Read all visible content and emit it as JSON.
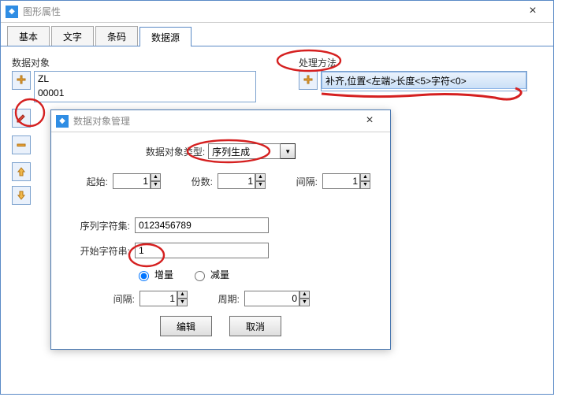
{
  "window": {
    "title": "图形属性",
    "close_glyph": "×"
  },
  "tabs": {
    "items": [
      "基本",
      "文字",
      "条码",
      "数据源"
    ],
    "active_index": 3
  },
  "data_object": {
    "label": "数据对象",
    "items": [
      "ZL",
      "00001"
    ]
  },
  "method": {
    "label": "处理方法",
    "items": [
      "补齐,位置<左端>长度<5>字符<0>"
    ]
  },
  "dialog": {
    "title": "数据对象管理",
    "close_glyph": "×",
    "type_label": "数据对象类型:",
    "type_value": "序列生成",
    "start_label": "起始:",
    "start_value": "1",
    "copies_label": "份数:",
    "copies_value": "1",
    "interval_label": "间隔:",
    "interval_value": "1",
    "charset_label": "序列字符集:",
    "charset_value": "0123456789",
    "startstr_label": "开始字符串:",
    "startstr_value": "1",
    "radio_inc": "增量",
    "radio_dec": "减量",
    "interval2_label": "间隔:",
    "interval2_value": "1",
    "period_label": "周期:",
    "period_value": "0",
    "btn_edit": "编辑",
    "btn_cancel": "取消"
  },
  "icons": {
    "plus": "+",
    "dropdown": "▼",
    "spinner_up": "▲",
    "spinner_dn": "▼"
  }
}
